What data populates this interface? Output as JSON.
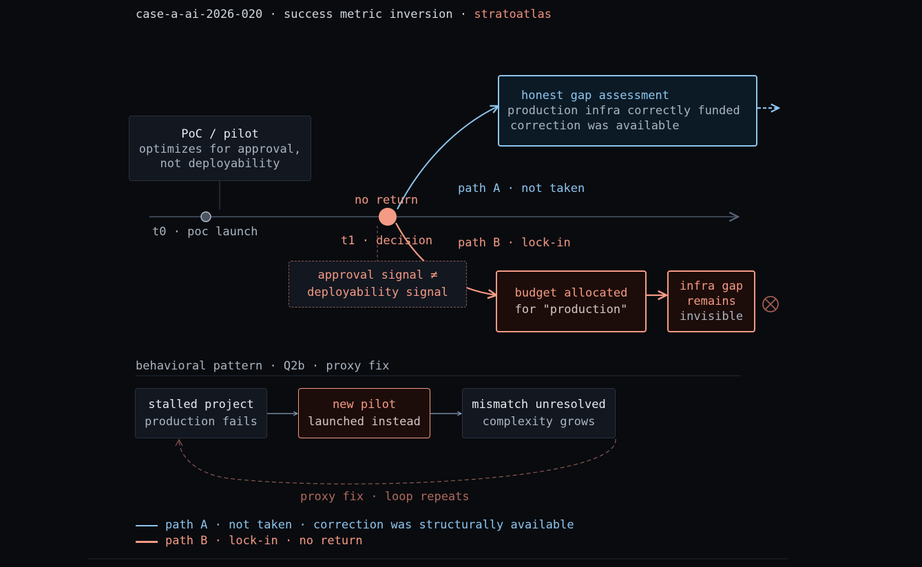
{
  "header": {
    "case_id": "case-a-ai-2026-020",
    "separator": "·",
    "subtitle": "success metric inversion",
    "brand": "stratoatlas"
  },
  "timeline": {
    "t0_label": "t0 · poc launch",
    "t1_label": "t1 · decision",
    "no_return_label": "no return"
  },
  "poc_box": {
    "title": "PoC / pilot",
    "line1": "optimizes for approval,",
    "line2": "not deployability"
  },
  "signal_box": {
    "line1": "approval signal ≠",
    "line2": "deployability signal"
  },
  "path_a": {
    "label": "path A · not taken",
    "box_title": "honest gap assessment",
    "box_line1": "production infra correctly funded",
    "box_line2": "correction was available"
  },
  "path_b": {
    "label": "path B · lock-in",
    "budget_line1": "budget allocated",
    "budget_line2": "for \"production\"",
    "gap_line1": "infra gap",
    "gap_line2": "remains",
    "gap_line3": "invisible"
  },
  "pattern": {
    "title": "behavioral pattern · Q2b · proxy fix",
    "stalled_title": "stalled project",
    "stalled_sub": "production fails",
    "pilot_title": "new pilot",
    "pilot_sub": "launched instead",
    "mismatch_title": "mismatch unresolved",
    "mismatch_sub": "complexity grows",
    "loop_label": "proxy fix · loop repeats"
  },
  "legend": {
    "path_a": "path A · not taken · correction was structurally available",
    "path_b": "path B · lock-in · no return"
  },
  "colors": {
    "background": "#090b0f",
    "path_a": "#8ec5ee",
    "path_b": "#f59a84",
    "neutral": "#aab4c0"
  },
  "icons": {
    "end_marker": "circle-x-icon",
    "continue_marker": "dashed-arrow-icon"
  }
}
